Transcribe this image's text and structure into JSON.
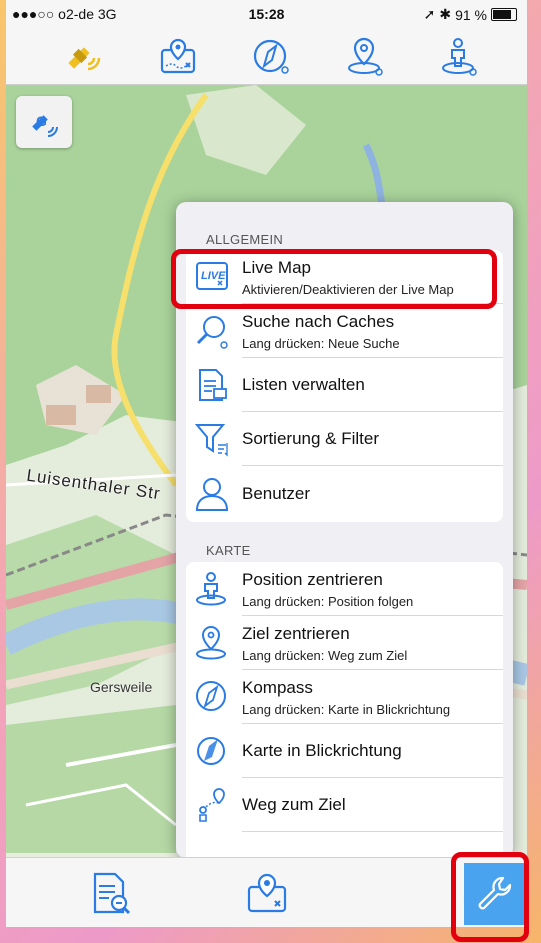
{
  "status_bar": {
    "carrier": "●●●○○ o2-de  3G",
    "time": "15:28",
    "battery": "91 %",
    "battery_level": 0.91
  },
  "toolbar": {
    "icons": [
      "satellite-icon",
      "live-map-icon",
      "compass-icon",
      "target-pin-icon",
      "position-icon"
    ]
  },
  "map": {
    "street_label": "Luisenthaler Str",
    "town_label": "Gersweile"
  },
  "menu": {
    "section_general": "ALLGEMEIN",
    "section_map": "KARTE",
    "items": [
      {
        "title": "Live Map",
        "subtitle": "Aktivieren/Deaktivieren der Live Map"
      },
      {
        "title": "Suche nach Caches",
        "subtitle": "Lang drücken: Neue Suche"
      },
      {
        "title": "Listen verwalten",
        "subtitle": ""
      },
      {
        "title": "Sortierung & Filter",
        "subtitle": ""
      },
      {
        "title": "Benutzer",
        "subtitle": ""
      },
      {
        "title": "Position zentrieren",
        "subtitle": "Lang drücken: Position folgen"
      },
      {
        "title": "Ziel zentrieren",
        "subtitle": "Lang drücken: Weg zum Ziel"
      },
      {
        "title": "Kompass",
        "subtitle": "Lang drücken: Karte in Blickrichtung"
      },
      {
        "title": "Karte in Blickrichtung",
        "subtitle": ""
      },
      {
        "title": "Weg zum Ziel",
        "subtitle": ""
      }
    ]
  },
  "colors": {
    "accent": "#2a7be4",
    "highlight": "#e2000f",
    "settings_bg": "#4aa3ee"
  }
}
